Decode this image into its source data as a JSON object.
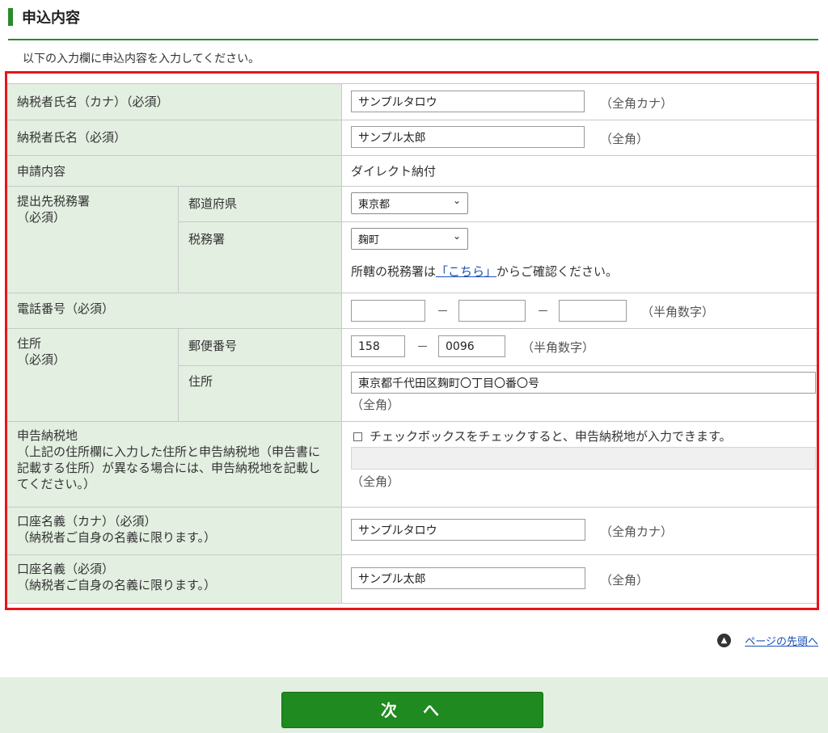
{
  "section": {
    "title": "申込内容",
    "intro": "以下の入力欄に申込内容を入力してください。"
  },
  "rows": {
    "name_kana": {
      "label": "納税者氏名（カナ）（必須）",
      "value": "サンプルタロウ",
      "hint": "（全角カナ）"
    },
    "name": {
      "label": "納税者氏名（必須）",
      "value": "サンプル太郎",
      "hint": "（全角）"
    },
    "application": {
      "label": "申請内容",
      "value": "ダイレクト納付"
    },
    "tax_office": {
      "label": "提出先税務署\n（必須）",
      "pref_label": "都道府県",
      "pref_value": "東京都",
      "office_label": "税務署",
      "office_value": "麹町",
      "note_before": "所轄の税務署は",
      "note_link": "「こちら」",
      "note_after": "からご確認ください。"
    },
    "phone": {
      "label": "電話番号（必須）",
      "dash": "－",
      "hint": "（半角数字）",
      "part1": "",
      "part2": "",
      "part3": ""
    },
    "address": {
      "label": "住所\n（必須）",
      "zip_label": "郵便番号",
      "zip1": "158",
      "zip2": "0096",
      "zip_dash": "－",
      "zip_hint": "（半角数字）",
      "addr_label": "住所",
      "addr_value": "東京都千代田区麹町〇丁目〇番〇号",
      "addr_hint": "（全角）"
    },
    "tax_place": {
      "label": "申告納税地\n（上記の住所欄に入力した住所と申告納税地（申告書に記載する住所）が異なる場合には、申告納税地を記載してください。）",
      "checkbox_text": "チェックボックスをチェックすると、申告納税地が入力できます。",
      "value": "",
      "hint": "（全角）"
    },
    "account_kana": {
      "label": "口座名義（カナ）（必須）\n（納税者ご自身の名義に限ります。）",
      "value": "サンプルタロウ",
      "hint": "（全角カナ）"
    },
    "account": {
      "label": "口座名義（必須）\n（納税者ご自身の名義に限ります。）",
      "value": "サンプル太郎",
      "hint": "（全角）"
    }
  },
  "page_top": "ページの先頭へ",
  "next_button": "次　へ",
  "icons": {
    "select": "chevron-down-icon",
    "page_top": "chevron-up-circle-icon"
  },
  "colors": {
    "accent": "#1f8a1f",
    "label_bg": "#e3efe1",
    "highlight": "#e8141b",
    "link": "#1a4fb8"
  }
}
